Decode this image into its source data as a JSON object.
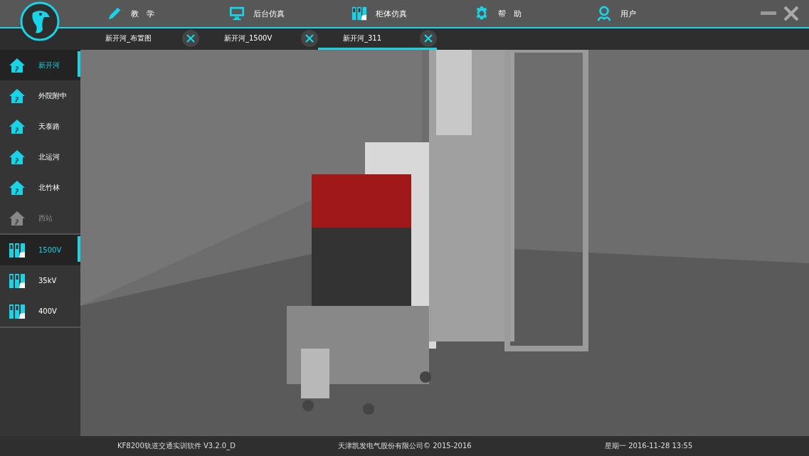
{
  "nav": [
    {
      "kind": "pencil",
      "label": "教　学"
    },
    {
      "kind": "monitor",
      "label": "后台仿真"
    },
    {
      "kind": "cabinet",
      "label": "柜体仿真"
    },
    {
      "kind": "gear",
      "label": "帮　助"
    },
    {
      "kind": "user",
      "label": "用户"
    }
  ],
  "tabs": [
    {
      "label": "新开河_布置图",
      "selected": false
    },
    {
      "label": "新开河_1500V",
      "selected": false
    },
    {
      "label": "新开河_311",
      "selected": true
    }
  ],
  "sidebar": {
    "groups": [
      {
        "items": [
          {
            "kind": "station",
            "label": "新开河",
            "selected": true,
            "disabled": false
          },
          {
            "kind": "station",
            "label": "外院附中",
            "selected": false,
            "disabled": false
          },
          {
            "kind": "station",
            "label": "天泰路",
            "selected": false,
            "disabled": false
          },
          {
            "kind": "station",
            "label": "北运河",
            "selected": false,
            "disabled": false
          },
          {
            "kind": "station",
            "label": "北竹林",
            "selected": false,
            "disabled": false
          },
          {
            "kind": "station",
            "label": "西站",
            "selected": false,
            "disabled": true
          }
        ]
      },
      {
        "items": [
          {
            "kind": "cabinet",
            "label": "1500V",
            "selected": true,
            "disabled": false
          },
          {
            "kind": "cabinet",
            "label": "35kV",
            "selected": false,
            "disabled": false
          },
          {
            "kind": "cabinet",
            "label": "400V",
            "selected": false,
            "disabled": false
          }
        ]
      }
    ]
  },
  "status_bar": {
    "software": "KF8200轨道交通实训软件 V3.2.0_D",
    "company": "天津凯发电气股份有限公司© 2015-2016",
    "datetime": "星期一 2016-11-28 13:55"
  }
}
